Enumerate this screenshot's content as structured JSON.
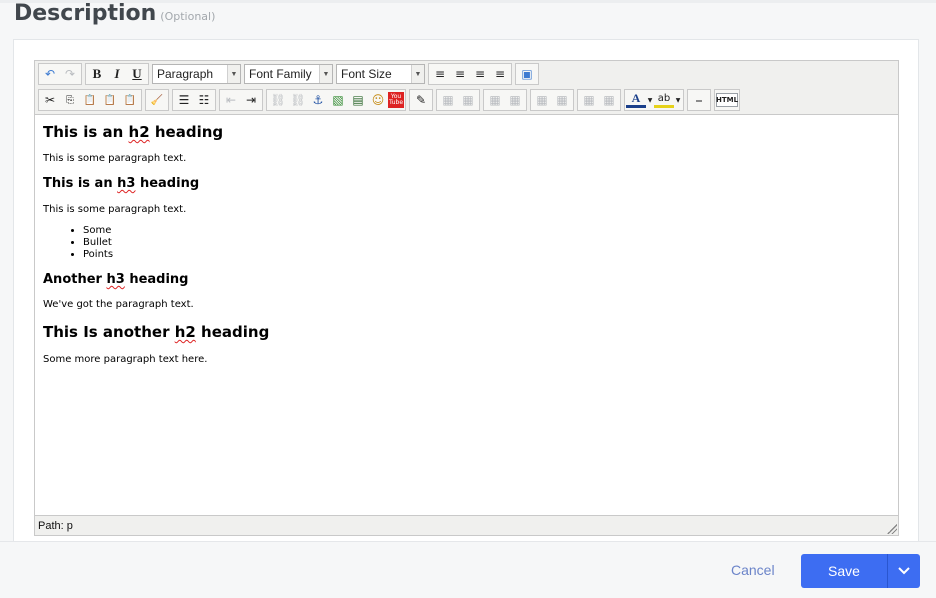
{
  "section": {
    "title": "Description",
    "optional_label": "(Optional)"
  },
  "toolbar": {
    "row1": {
      "undo": "↶",
      "redo": "↷",
      "bold": "B",
      "italic": "I",
      "underline": "U",
      "block_format": "Paragraph",
      "font_family": "Font Family",
      "font_size": "Font Size",
      "align_left": "≡",
      "align_center": "≡",
      "align_right": "≡",
      "align_justify": "≡",
      "fullscreen": "▣"
    },
    "row2": {
      "cut": "✂",
      "copy": "⎘",
      "paste": "📋",
      "paste_text": "📋",
      "paste_word": "📋",
      "cleanup": "🧹",
      "bullet_list": "☰",
      "numbered_list": "☷",
      "outdent": "⇤",
      "indent": "⇥",
      "link": "⛓",
      "unlink": "⛓",
      "anchor": "⚓",
      "image": "▧",
      "media": "▤",
      "emotion": "☺",
      "youtube": "You\nTube",
      "edit": "✎",
      "table_icons": [
        "▦",
        "▦",
        "▦",
        "▦",
        "▦",
        "▦",
        "▦",
        "▦"
      ],
      "forecolor": "A",
      "backcolor": "ab",
      "hr": "⎯",
      "html": "HTML"
    }
  },
  "content": {
    "h2_1_pre": "This is an ",
    "h2_1_spell": "h2",
    "h2_1_post": " heading",
    "p1": "This is some paragraph text.",
    "h3_1_pre": "This is an ",
    "h3_1_spell": "h3",
    "h3_1_post": " heading",
    "p2": "This is some paragraph text.",
    "bullets": [
      "Some",
      "Bullet",
      "Points"
    ],
    "h3_2_pre": "Another ",
    "h3_2_spell": "h3",
    "h3_2_post": " heading",
    "p3": "We've got the paragraph text.",
    "h2_2_pre": "This Is another ",
    "h2_2_spell": "h2",
    "h2_2_post": " heading",
    "p4": "Some more paragraph text here."
  },
  "statusbar": {
    "path": "Path: p"
  },
  "footer": {
    "cancel": "Cancel",
    "save": "Save",
    "save_menu_icon": "chevron-down-icon"
  },
  "colors": {
    "primary": "#3d6df2",
    "cancel": "#6b84c9",
    "heading": "#41474d"
  }
}
